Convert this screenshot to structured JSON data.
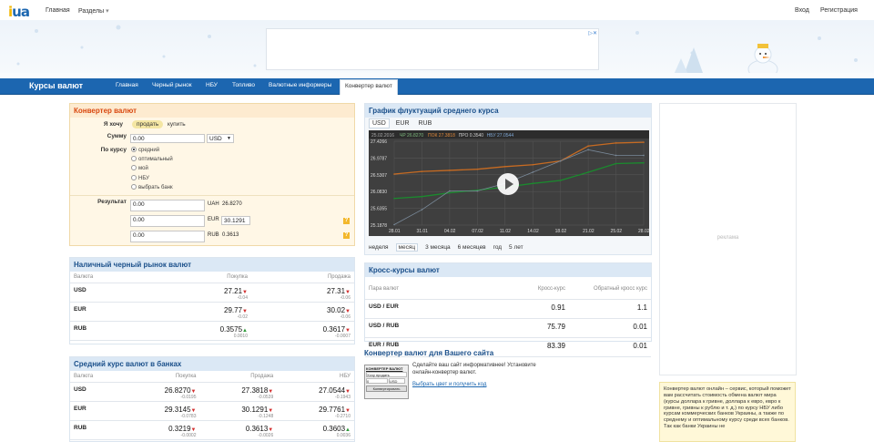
{
  "header": {
    "logo_text": "ua",
    "nav_links": [
      "Главная",
      "Разделы"
    ],
    "sections_arrow": "▾",
    "login": "Вход",
    "register": "Регистрация"
  },
  "navbar": {
    "title": "Курсы валют",
    "items": [
      "Главная",
      "Черный рынок",
      "НБУ",
      "Топливо",
      "Валютные информеры"
    ],
    "active": "Конвертер валют"
  },
  "converter": {
    "title": "Конвертер валют",
    "want_label": "Я хочу",
    "sell": "продать",
    "buy": "купить",
    "sum_label": "Сумму",
    "sum_value": "0.00",
    "currency": "USD",
    "rate_label": "По курсу",
    "rate_options": [
      "средний",
      "оптимальный",
      "мой",
      "НБУ",
      "выбрать банк"
    ],
    "result_label": "Результат",
    "results": [
      {
        "value": "0.00",
        "cur": "UAH",
        "rate": "26.8270"
      },
      {
        "value": "0.00",
        "cur": "EUR",
        "rate": "30.1291"
      },
      {
        "value": "0.00",
        "cur": "RUB",
        "rate": "0.3613"
      }
    ],
    "help": "?"
  },
  "black_market": {
    "title": "Наличный черный рынок валют",
    "headers": [
      "Валюта",
      "Покупка",
      "Продажа"
    ],
    "rows": [
      {
        "cur": "USD",
        "buy": "27.21",
        "buy_chg": "-0.04",
        "buy_dir": "down",
        "sell": "27.31",
        "sell_chg": "-0.06",
        "sell_dir": "down"
      },
      {
        "cur": "EUR",
        "buy": "29.77",
        "buy_chg": "-0.02",
        "buy_dir": "down",
        "sell": "30.02",
        "sell_chg": "-0.06",
        "sell_dir": "down"
      },
      {
        "cur": "RUB",
        "buy": "0.3575",
        "buy_chg": "0.0010",
        "buy_dir": "up",
        "sell": "0.3617",
        "sell_chg": "-0.0007",
        "sell_dir": "down"
      }
    ]
  },
  "banks": {
    "title": "Средний курс валют в банках",
    "headers": [
      "Валюта",
      "Покупка",
      "Продажа",
      "НБУ"
    ],
    "rows": [
      {
        "cur": "USD",
        "buy": "26.8270",
        "buy_chg": "-0.0195",
        "buy_dir": "down",
        "sell": "27.3818",
        "sell_chg": "-0.0539",
        "sell_dir": "down",
        "nbu": "27.0544",
        "nbu_chg": "-0.1943",
        "nbu_dir": "down"
      },
      {
        "cur": "EUR",
        "buy": "29.3145",
        "buy_chg": "-0.0783",
        "buy_dir": "down",
        "sell": "30.1291",
        "sell_chg": "-0.1248",
        "sell_dir": "down",
        "nbu": "29.7761",
        "nbu_chg": "-0.2710",
        "nbu_dir": "down"
      },
      {
        "cur": "RUB",
        "buy": "0.3219",
        "buy_chg": "-0.0002",
        "buy_dir": "down",
        "sell": "0.3613",
        "sell_chg": "-0.0026",
        "sell_dir": "down",
        "nbu": "0.3603",
        "nbu_chg": "0.0036",
        "nbu_dir": "up"
      }
    ]
  },
  "chart": {
    "title": "График флуктуаций среднего курса",
    "tabs": [
      "USD",
      "EUR",
      "RUB"
    ],
    "active_tab": "USD",
    "legend": [
      "25.02.2016",
      "ЧР 26.8270",
      "ПОК 27.3818",
      "ПРО 0.3540",
      "НБУ 27.0544"
    ],
    "y_ticks": [
      "27.4266",
      "26.9787",
      "26.5307",
      "26.0830",
      "25.6355",
      "25.1878"
    ],
    "x_ticks": [
      "28.01",
      "31.01",
      "04.02",
      "07.02",
      "11.02",
      "14.02",
      "18.02",
      "21.02",
      "25.02",
      "28.02"
    ],
    "periods": [
      "неделя",
      "месяц",
      "3 месяца",
      "6 месяцев",
      "год",
      "5 лет"
    ],
    "active_period": "месяц",
    "line_colors": [
      "#c76b22",
      "#1b8a2e",
      "#7a8a9a"
    ]
  },
  "chart_data": {
    "type": "line",
    "x": [
      "28.01",
      "31.01",
      "04.02",
      "07.02",
      "11.02",
      "14.02",
      "18.02",
      "21.02",
      "25.02",
      "28.02"
    ],
    "series": [
      {
        "name": "ПОК",
        "values": [
          26.55,
          26.62,
          26.65,
          26.68,
          26.75,
          26.8,
          26.9,
          27.3,
          27.38,
          27.4
        ]
      },
      {
        "name": "ЧР",
        "values": [
          25.9,
          25.95,
          26.05,
          26.12,
          26.2,
          26.3,
          26.38,
          26.6,
          26.83,
          26.85
        ]
      },
      {
        "name": "НБУ",
        "values": [
          25.2,
          25.6,
          26.1,
          26.1,
          26.3,
          26.6,
          26.9,
          27.2,
          27.05,
          27.05
        ]
      }
    ],
    "ylim": [
      25.1878,
      27.4266
    ]
  },
  "cross": {
    "title": "Кросс-курсы валют",
    "headers": [
      "Пара валют",
      "Кросс-курс",
      "Обратный кросс курс"
    ],
    "rows": [
      {
        "pair": "USD / EUR",
        "rate": "0.91",
        "rev": "1.1"
      },
      {
        "pair": "USD / RUB",
        "rate": "75.79",
        "rev": "0.01"
      },
      {
        "pair": "EUR / RUB",
        "rate": "83.39",
        "rev": "0.01"
      }
    ]
  },
  "widget": {
    "title": "Конвертер валют для Вашего сайта",
    "desc": "Сделайте ваш сайт информативнее! Установите онлайн-конвертер валют.",
    "link": "Выбрать цвет и получить код",
    "preview_title": "КОНВЕРТЕР ВАЛЮТ",
    "preview_select": "Хочу продать",
    "preview_cur": "USD",
    "preview_btn": "Конвертировать",
    "preview_input": "0"
  },
  "ad": {
    "label": "реклама"
  },
  "promo_text": "Конвертер валют онлайн – сервис, который поможет вам рассчитать стоимость обмена валют мира (курсы доллара к гривне, доллара к евро, евро к гривне, гривны к рублю и т. д.) по курсу НБУ либо курсам коммерческих банков Украины, а также по среднему и оптимальному курсу среди всех банков. Так как банки Украины не"
}
